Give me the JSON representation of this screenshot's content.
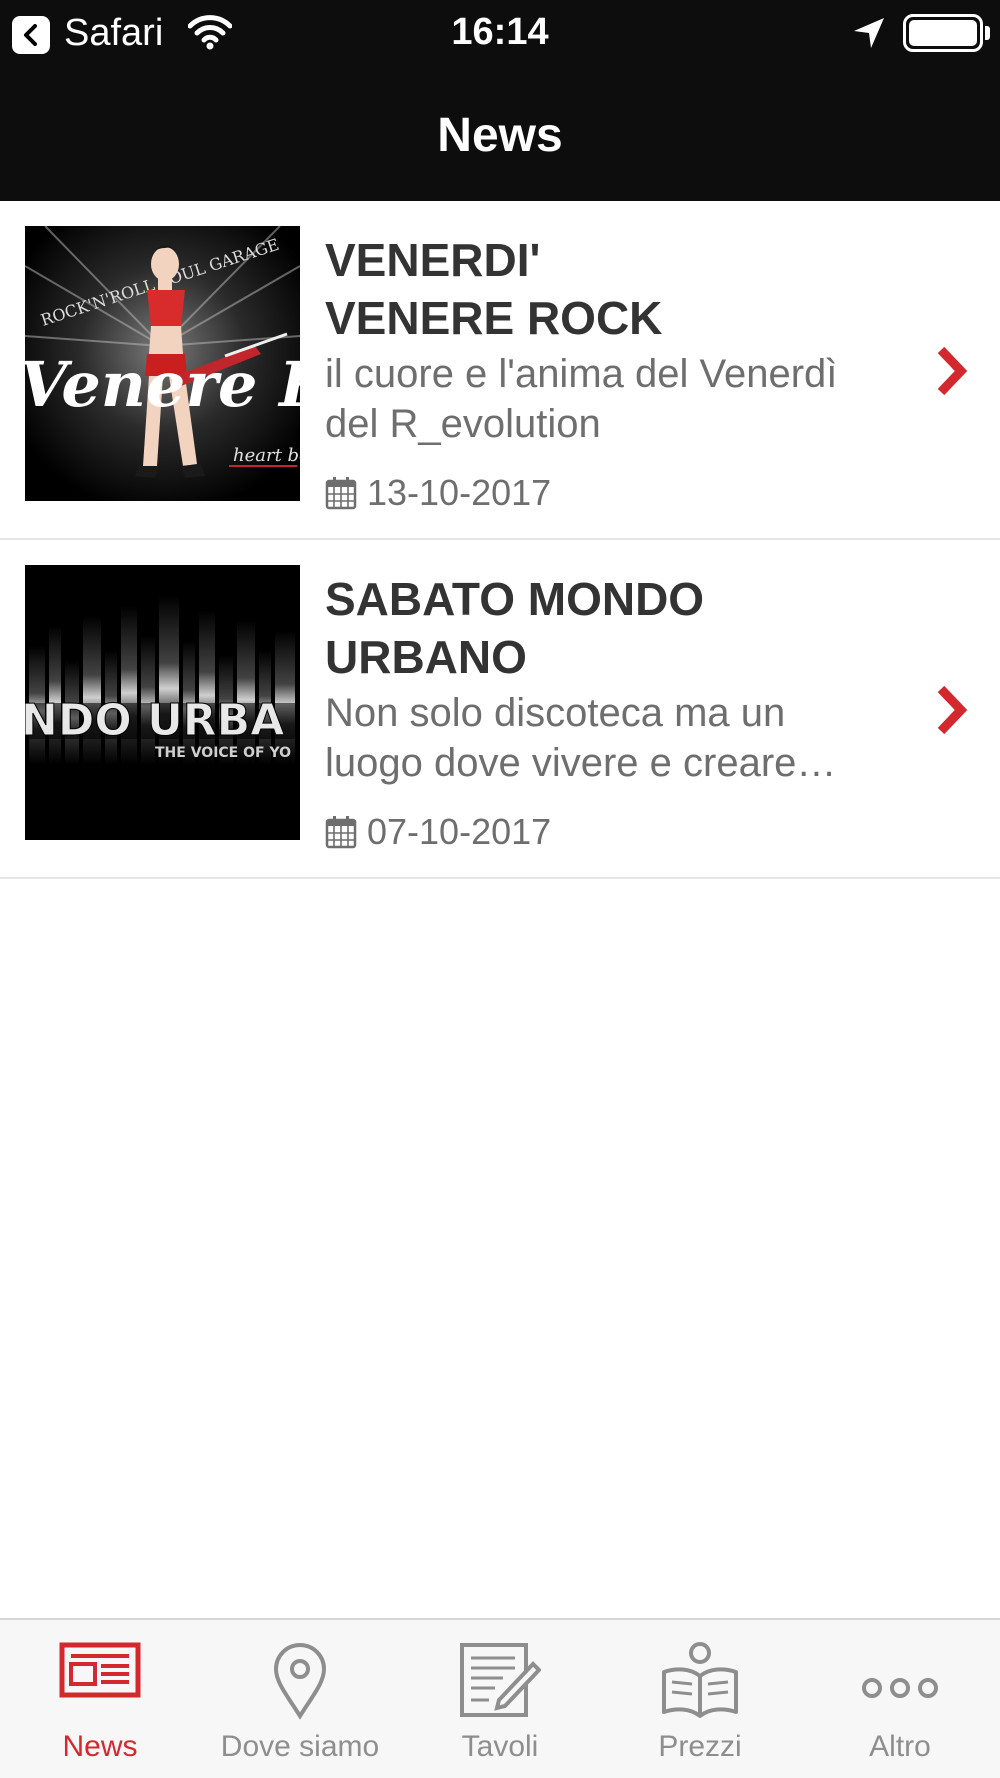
{
  "status_bar": {
    "back_label": "Safari",
    "time": "16:14"
  },
  "nav": {
    "title": "News"
  },
  "colors": {
    "accent": "#d4282f",
    "nav_bg": "#0d0d0d",
    "text_dark": "#333333",
    "text_gray": "#6e6e6e",
    "tab_gray": "#8e8e8e"
  },
  "news": [
    {
      "title_line1": "VENERDI'",
      "title_line2": "VENERE ROCK",
      "desc_line1": "il cuore e l'anima del Venerdì",
      "desc_line2": "del R_evolution",
      "date": "13-10-2017",
      "thumb_text_main": "Venere Rock",
      "thumb_text_top": "ROCK'N'ROLL   SOUL GARAGE",
      "thumb_text_sub": "heart beat"
    },
    {
      "title_line1": "SABATO MONDO",
      "title_line2": "URBANO",
      "desc_line1": "Non solo discoteca ma un",
      "desc_line2": "luogo dove vivere e creare…",
      "date": "07-10-2017",
      "thumb_text_main": "NDO URBA",
      "thumb_text_sub": "THE VOICE OF YO"
    }
  ],
  "tabs": [
    {
      "label": "News",
      "icon": "newspaper-icon",
      "active": true
    },
    {
      "label": "Dove siamo",
      "icon": "map-pin-icon",
      "active": false
    },
    {
      "label": "Tavoli",
      "icon": "edit-note-icon",
      "active": false
    },
    {
      "label": "Prezzi",
      "icon": "open-book-icon",
      "active": false
    },
    {
      "label": "Altro",
      "icon": "more-icon",
      "active": false
    }
  ]
}
